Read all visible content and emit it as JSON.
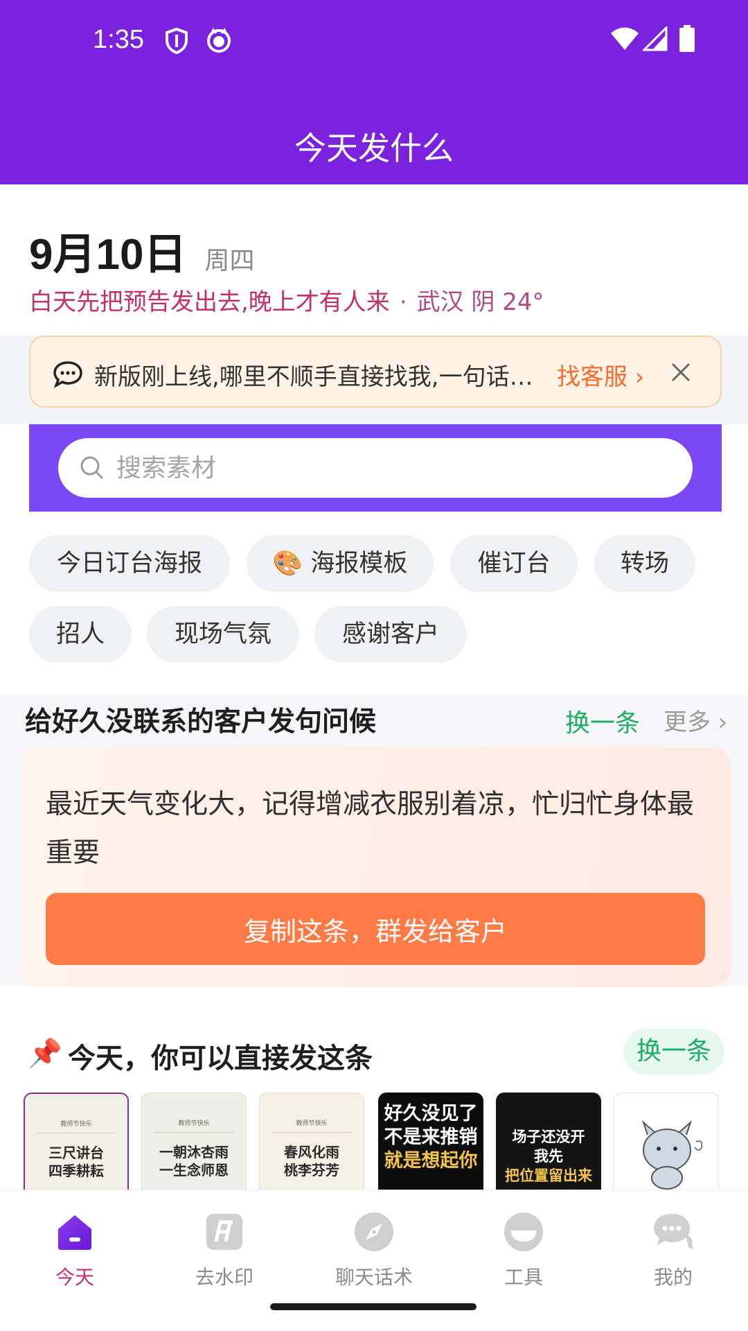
{
  "status_bar": {
    "time": "1:35",
    "icons": [
      "shield-icon",
      "cat-face-icon",
      "wifi-icon",
      "cellular-signal-icon",
      "battery-icon"
    ]
  },
  "header": {
    "title": "今天发什么"
  },
  "date": {
    "day": "9月10日",
    "weekday": "周四",
    "tip": "白天先把预告发出去,晚上才有人来",
    "separator": "·",
    "weather": "武汉 阴 24°"
  },
  "notice": {
    "icon": "chat-bubble-icon",
    "text": "新版刚上线,哪里不顺手直接找我,一句话就行",
    "link": "找客服 ›"
  },
  "search": {
    "placeholder": "搜索素材"
  },
  "chips": [
    {
      "label": "今日订台海报"
    },
    {
      "label": "海报模板",
      "emoji": "🎨"
    },
    {
      "label": "催订台"
    },
    {
      "label": "转场"
    },
    {
      "label": "招人"
    },
    {
      "label": "现场气氛"
    },
    {
      "label": "感谢客户"
    }
  ],
  "greeting_section": {
    "title": "给好久没联系的客户发句问候",
    "refresh": "换一条",
    "more": "更多 ›",
    "message": "最近天气变化大，记得增减衣服别着凉，忙归忙身体最重要",
    "copy_button": "复制这条，群发给客户"
  },
  "today_section": {
    "pin_icon": "📌",
    "title": "今天，你可以直接发这条",
    "refresh": "换一条",
    "thumbnails": [
      {
        "kind": "light",
        "tag": "教师节快乐",
        "line1": "三尺讲台",
        "line2": "四季耕耘"
      },
      {
        "kind": "light",
        "tag": "教师节快乐",
        "line1": "一朝沐杏雨",
        "line2": "一生念师恩"
      },
      {
        "kind": "light",
        "tag": "教师节快乐",
        "line1": "春风化雨",
        "line2": "桃李芬芳"
      },
      {
        "kind": "dark",
        "line1": "好久没见了",
        "line2": "不是来推销",
        "line3": "就是想起你"
      },
      {
        "kind": "dark",
        "line1": "场子还没开",
        "line2": "我先",
        "line3": "把位置留出来"
      },
      {
        "kind": "sticker"
      }
    ]
  },
  "tabbar": {
    "items": [
      {
        "label": "今天",
        "icon": "home-icon",
        "active": true
      },
      {
        "label": "去水印",
        "icon": "watermark-icon",
        "active": false
      },
      {
        "label": "聊天话术",
        "icon": "compass-icon",
        "active": false
      },
      {
        "label": "工具",
        "icon": "tools-icon",
        "active": false
      },
      {
        "label": "我的",
        "icon": "profile-chat-icon",
        "active": false
      }
    ]
  },
  "colors": {
    "brand_purple": "#7a22dd",
    "search_band": "#7b46f4",
    "accent_pink": "#c2306b",
    "accent_orange": "#ff7a44",
    "accent_green": "#1fae66"
  }
}
